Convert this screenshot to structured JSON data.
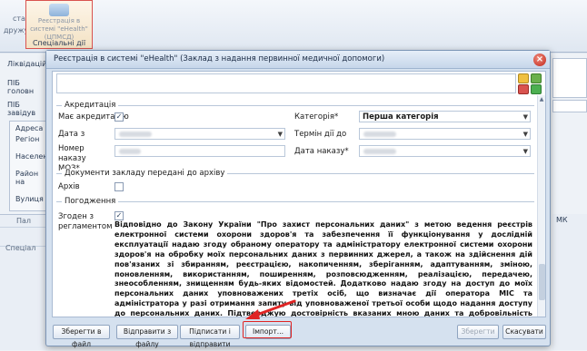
{
  "ribbon": {
    "left_labels": [
      "стана",
      "дружу"
    ],
    "button_text": "Реєстрація в системі \"eHealth\" (ЦПМСД)",
    "group_label": "Спеціальні дії"
  },
  "background": {
    "fields": [
      "Ліквідаційн",
      "ПІБ головн",
      "ПІБ завідув"
    ],
    "panel_items": [
      "Адреса",
      "Регіон",
      "Населен",
      "Район на",
      "Вулиця"
    ],
    "grid_header": "Пал",
    "grid_row": "Спеціал",
    "right_header": "МК"
  },
  "dialog": {
    "title": "Реєстрація в системі \"eHealth\" (Заклад з надання первинної медичної допомоги)",
    "accreditation": {
      "section_title": "Акредитація",
      "has_label": "Має акредитацію",
      "has_checked": true,
      "category_label": "Категорія*",
      "category_value": "Перша категорія",
      "date_from_label": "Дата з",
      "term_label": "Термін дії до",
      "order_number_label": "Номер наказу МОЗ*",
      "order_date_label": "Дата наказу*"
    },
    "archive": {
      "section_title": "Документи закладу передані до архіву",
      "label": "Архів",
      "checked": false
    },
    "consent": {
      "section_title": "Погодження",
      "label": "Згоден з регламентом",
      "checked": true,
      "text": "Відповідно до Закону України \"Про захист персональних даних\" з метою ведення реєстрів електронної системи охорони здоров'я та забезпечення її функціонування у дослідній експлуатації надаю згоду обраному оператору та адміністратору електронної системи охорони здоров'я на обробку моїх персональних даних з первинних джерел, а також на здійснення дій пов'язаних зі збиранням, реєстрацією, накопиченням, зберіганням, адаптуванням, зміною, поновленням, використанням, поширенням, розповсюдженням, реалізацією, передачею, знеособленням, знищенням будь-яких відомостей. Додатково надаю згоду на доступ до моїх персональних даних уповноважених третіх осіб, що визначає дії оператора МІС та адміністратора у разі отримання запиту від уповноваженої третьої особи щодо надання доступу до персональних даних. Підтверджую достовірність вказаних мною даних та добровільність надання цих даних до електронної системи охорони здоров'я, що працює у дослідній експлуатації. Усвідомлюю, що у випадку надання мною невірної інформації, мені може бути відмовлено в реєстрації в електронній системі охорони здоров'я. Зобов'язуюсь дотримуватись Регламенту функціонування електронної системи охорони здоров'я."
    },
    "buttons": {
      "save_file": "Зберегти в файл",
      "send_file": "Відправити з файлу",
      "sign_send": "Підписати і відправити",
      "import": "Імпорт...",
      "save": "Зберегти",
      "cancel": "Скасувати"
    },
    "colors": {
      "highlight": "#e02424",
      "accent": "#2b579a"
    }
  }
}
